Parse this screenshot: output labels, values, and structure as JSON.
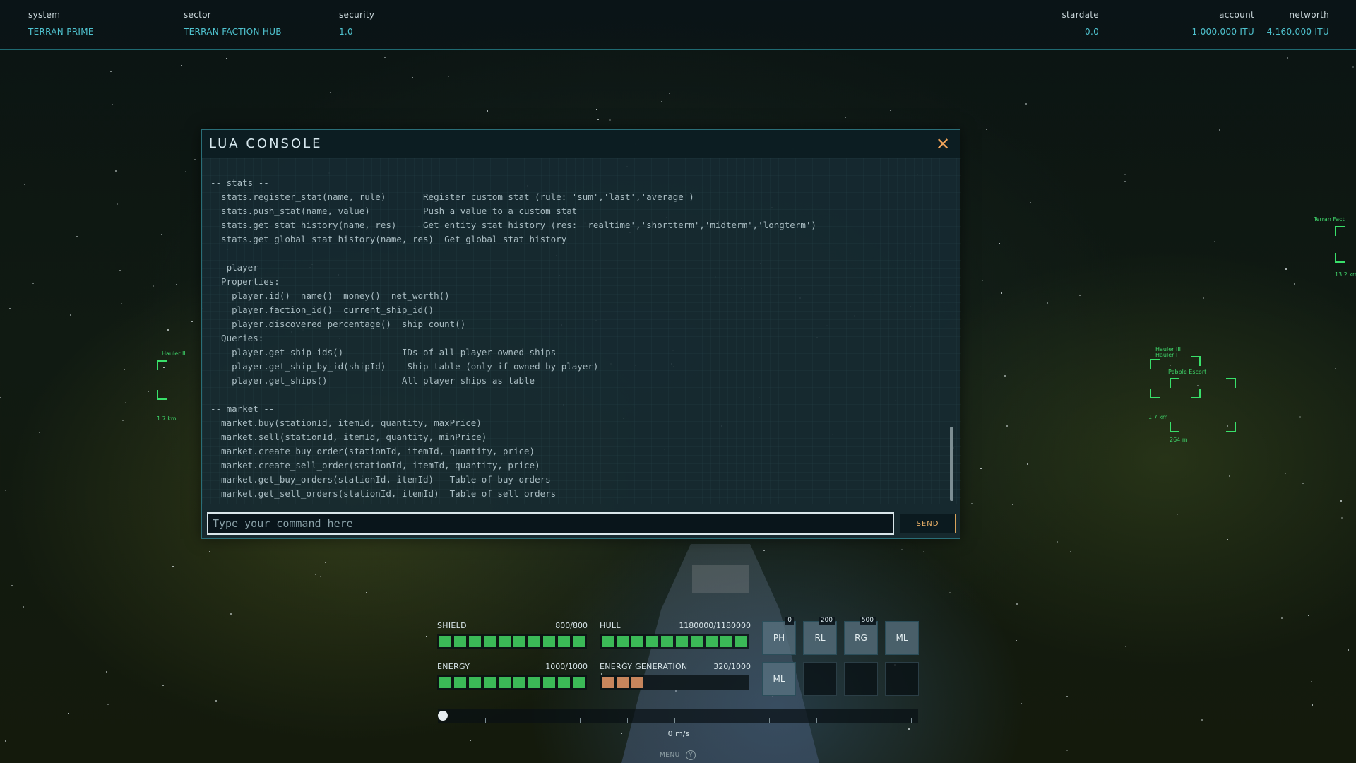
{
  "topbar": {
    "system_label": "system",
    "system_value": "TERRAN PRIME",
    "sector_label": "sector",
    "sector_value": "TERRAN FACTION HUB",
    "security_label": "security",
    "security_value": "1.0",
    "stardate_label": "stardate",
    "stardate_value": "0.0",
    "account_label": "account",
    "account_value": "1.000.000 ITU",
    "networth_label": "networth",
    "networth_value": "4.160.000 ITU"
  },
  "console": {
    "title": "LUA CONSOLE",
    "close_icon": "close-icon",
    "lines": [
      "-- stats --",
      "  stats.register_stat(name, rule)       Register custom stat (rule: 'sum','last','average')",
      "  stats.push_stat(name, value)          Push a value to a custom stat",
      "  stats.get_stat_history(name, res)     Get entity stat history (res: 'realtime','shortterm','midterm','longterm')",
      "  stats.get_global_stat_history(name, res)  Get global stat history",
      "",
      "-- player --",
      "  Properties:",
      "    player.id()  name()  money()  net_worth()",
      "    player.faction_id()  current_ship_id()",
      "    player.discovered_percentage()  ship_count()",
      "  Queries:",
      "    player.get_ship_ids()           IDs of all player-owned ships",
      "    player.get_ship_by_id(shipId)    Ship table (only if owned by player)",
      "    player.get_ships()              All player ships as table",
      "",
      "-- market --",
      "  market.buy(stationId, itemId, quantity, maxPrice)",
      "  market.sell(stationId, itemId, quantity, minPrice)",
      "  market.create_buy_order(stationId, itemId, quantity, price)",
      "  market.create_sell_order(stationId, itemId, quantity, price)",
      "  market.get_buy_orders(stationId, itemId)   Table of buy orders",
      "  market.get_sell_orders(stationId, itemId)  Table of sell orders"
    ],
    "input_placeholder": "Type your command here",
    "send_label": "SEND"
  },
  "targets": [
    {
      "label": "Hauler II",
      "distance": "1.7 km"
    },
    {
      "label": "Hauler III",
      "sublabel": "Hauler I",
      "distance": "1.7 km"
    },
    {
      "label": "Pebble Escort",
      "distance": "264 m"
    },
    {
      "label": "Terran Fact",
      "distance": "13.2 km"
    }
  ],
  "hud": {
    "shield_label": "SHIELD",
    "shield_value": "800/800",
    "shield_fraction": 1.0,
    "hull_label": "HULL",
    "hull_value": "1180000/1180000",
    "hull_fraction": 1.0,
    "energy_label": "ENERGY",
    "energy_value": "1000/1000",
    "energy_fraction": 1.0,
    "energy_gen_label": "ENERGY GENERATION",
    "energy_gen_value": "320/1000",
    "energy_gen_fraction": 0.32,
    "weapons": [
      {
        "label": "PH",
        "badge": "0"
      },
      {
        "label": "RL",
        "badge": "200"
      },
      {
        "label": "RG",
        "badge": "500"
      },
      {
        "label": "ML",
        "badge": ""
      },
      {
        "label": "ML",
        "badge": ""
      },
      {
        "label": "",
        "badge": ""
      },
      {
        "label": "",
        "badge": ""
      },
      {
        "label": "",
        "badge": ""
      }
    ],
    "speed_value": "0 m/s",
    "speed_fraction": 0.0,
    "menu_label": "MENU",
    "menu_key": "Y"
  },
  "colors": {
    "accent": "#4fc3cf",
    "bar_green": "#3bb957",
    "bar_orange": "#c7855c",
    "close_orange": "#f0a35a",
    "target_green": "#39e06a"
  }
}
